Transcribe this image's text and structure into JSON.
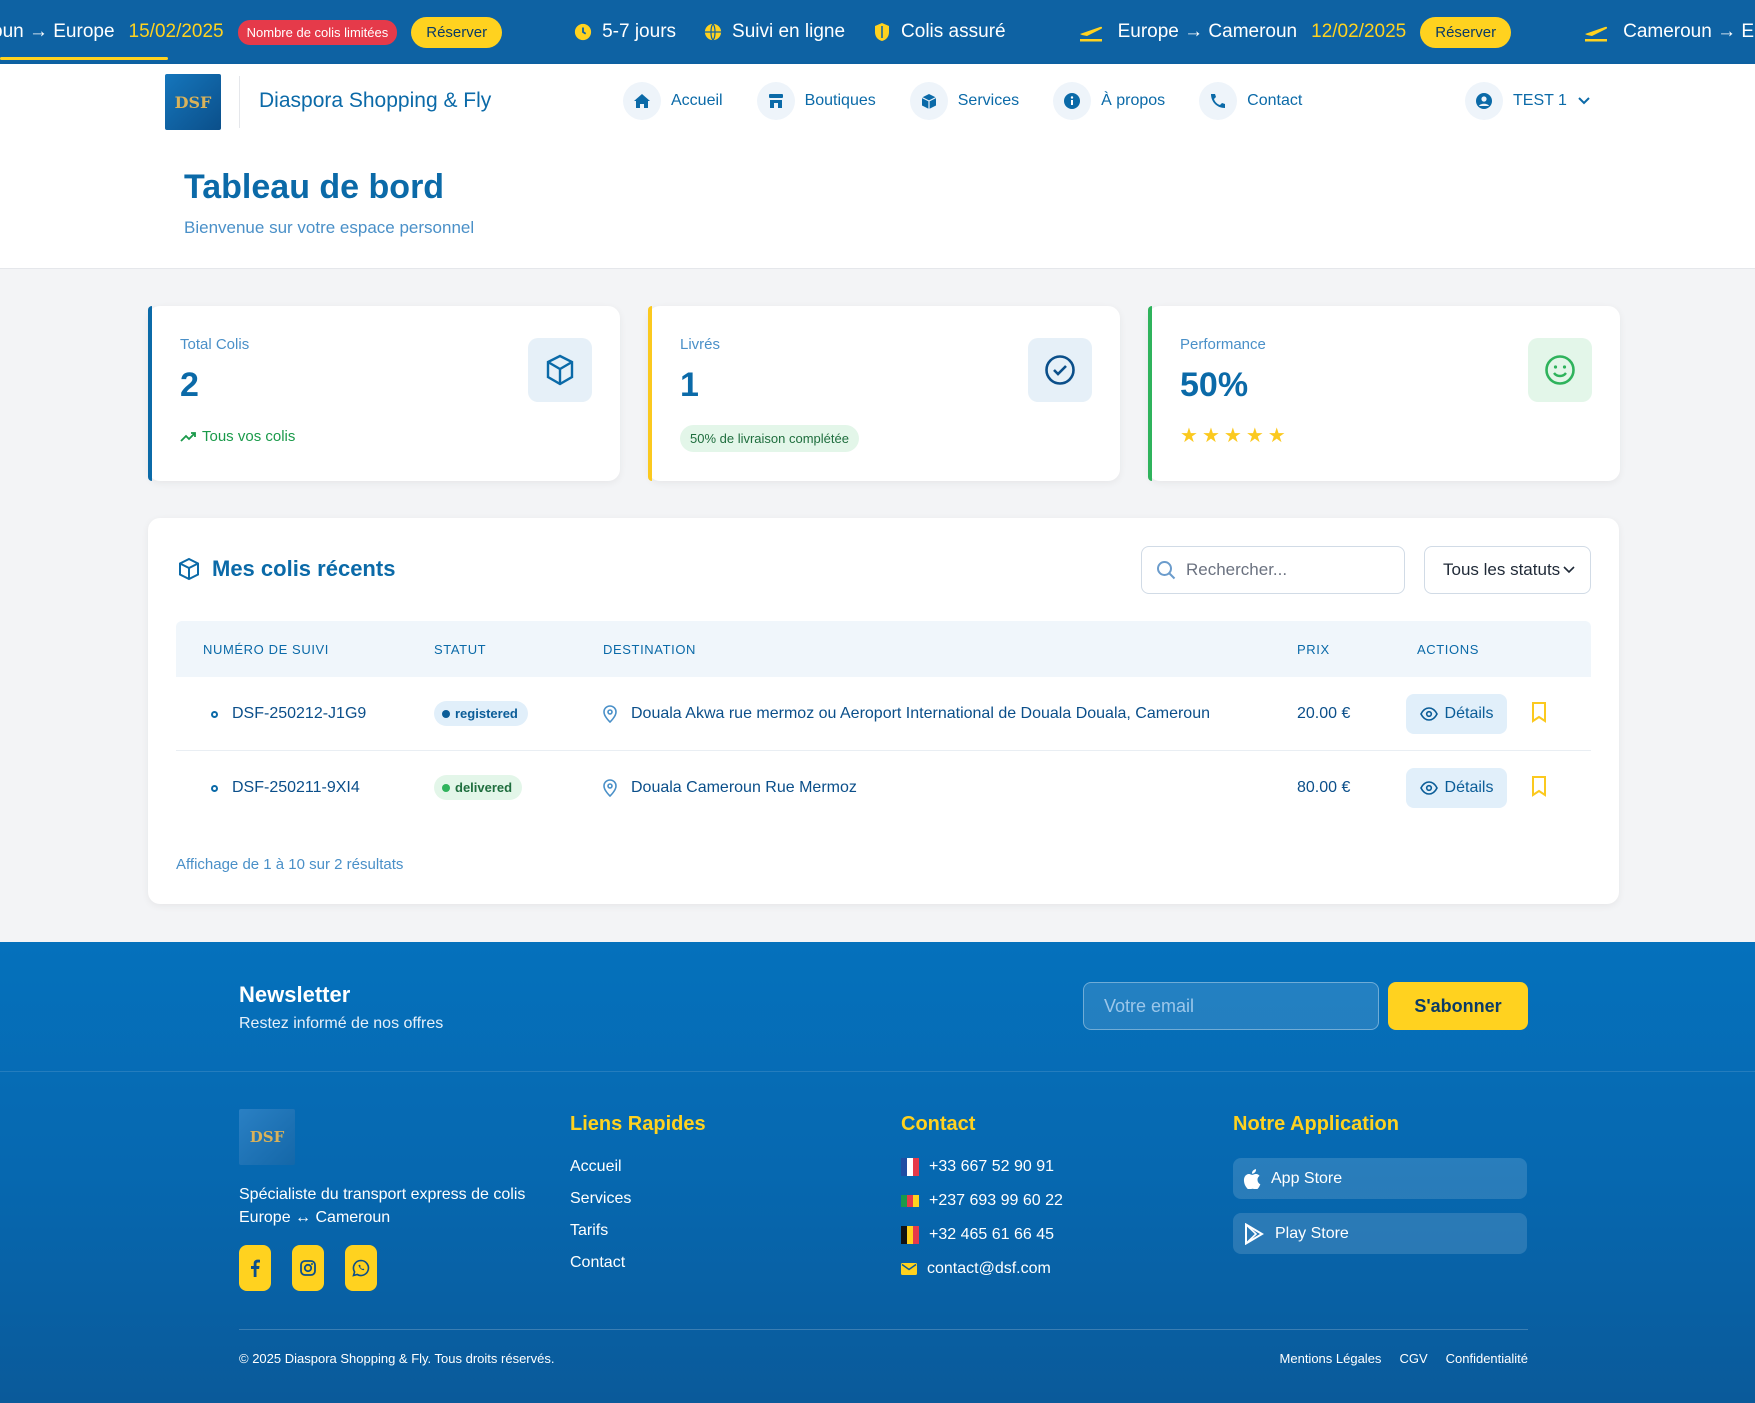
{
  "ticker": {
    "item1": {
      "route": "oun → Europe",
      "date": "15/02/2025",
      "limited": "Nombre de colis limitées",
      "button": "Réserver"
    },
    "features": [
      {
        "label": "5-7 jours",
        "icon": "clock-icon"
      },
      {
        "label": "Suivi en ligne",
        "icon": "globe-icon"
      },
      {
        "label": "Colis assuré",
        "icon": "shield-icon"
      }
    ],
    "item2": {
      "route": "Europe → Cameroun",
      "date": "12/02/2025",
      "button": "Réserver"
    },
    "item3": {
      "route": "Cameroun → Euro"
    }
  },
  "navbar": {
    "logo_text": "DSF",
    "brand": "Diaspora Shopping & Fly",
    "links": [
      {
        "label": "Accueil",
        "icon": "home-icon"
      },
      {
        "label": "Boutiques",
        "icon": "store-icon"
      },
      {
        "label": "Services",
        "icon": "box-icon"
      },
      {
        "label": "À propos",
        "icon": "info-icon"
      },
      {
        "label": "Contact",
        "icon": "phone-icon"
      }
    ],
    "user": "TEST 1"
  },
  "header": {
    "title": "Tableau de bord",
    "subtitle": "Bienvenue sur votre espace personnel"
  },
  "stats": {
    "total": {
      "label": "Total Colis",
      "value": "2",
      "note": "Tous vos colis"
    },
    "delivered": {
      "label": "Livrés",
      "value": "1",
      "pill": "50% de livraison complétée"
    },
    "performance": {
      "label": "Performance",
      "value": "50%",
      "stars": 5
    }
  },
  "parcels": {
    "title": "Mes colis récents",
    "search_placeholder": "Rechercher...",
    "status_filter": "Tous les statuts",
    "columns": [
      "NUMÉRO DE SUIVI",
      "STATUT",
      "DESTINATION",
      "PRIX",
      "ACTIONS"
    ],
    "rows": [
      {
        "tracking": "DSF-250212-J1G9",
        "status": "registered",
        "destination": "Douala Akwa rue mermoz ou Aeroport International de Douala Douala, Cameroun",
        "price": "20.00 €",
        "action": "Détails"
      },
      {
        "tracking": "DSF-250211-9XI4",
        "status": "delivered",
        "destination": "Douala Cameroun Rue Mermoz",
        "price": "80.00 €",
        "action": "Détails"
      }
    ],
    "pagination": "Affichage de 1 à 10 sur 2 résultats"
  },
  "footer": {
    "newsletter_title": "Newsletter",
    "newsletter_sub": "Restez informé de nos offres",
    "email_placeholder": "Votre email",
    "subscribe": "S'abonner",
    "logo_text": "DSF",
    "about": "Spécialiste du transport express de colis Europe ↔ Cameroun",
    "quick_links_title": "Liens Rapides",
    "quick_links": [
      "Accueil",
      "Services",
      "Tarifs",
      "Contact"
    ],
    "contact_title": "Contact",
    "contacts": [
      {
        "flag": "france",
        "text": "+33 667 52 90 91"
      },
      {
        "flag": "cameroon",
        "text": "+237 693 99 60 22"
      },
      {
        "flag": "belgium",
        "text": "+32 465 61 66 45"
      },
      {
        "flag": "mail-icon",
        "text": "contact@dsf.com"
      }
    ],
    "app_title": "Notre Application",
    "app_store": "App Store",
    "play_store": "Play Store",
    "copyright": "© 2025 Diaspora Shopping & Fly. Tous droits réservés.",
    "legal": [
      "Mentions Légales",
      "CGV",
      "Confidentialité"
    ]
  },
  "colors": {
    "primary": "#0b6aa8",
    "accent": "#ffd21f",
    "ticker_bg": "#0e62a3",
    "success": "#1a9a4a",
    "danger": "#e53a4a"
  }
}
